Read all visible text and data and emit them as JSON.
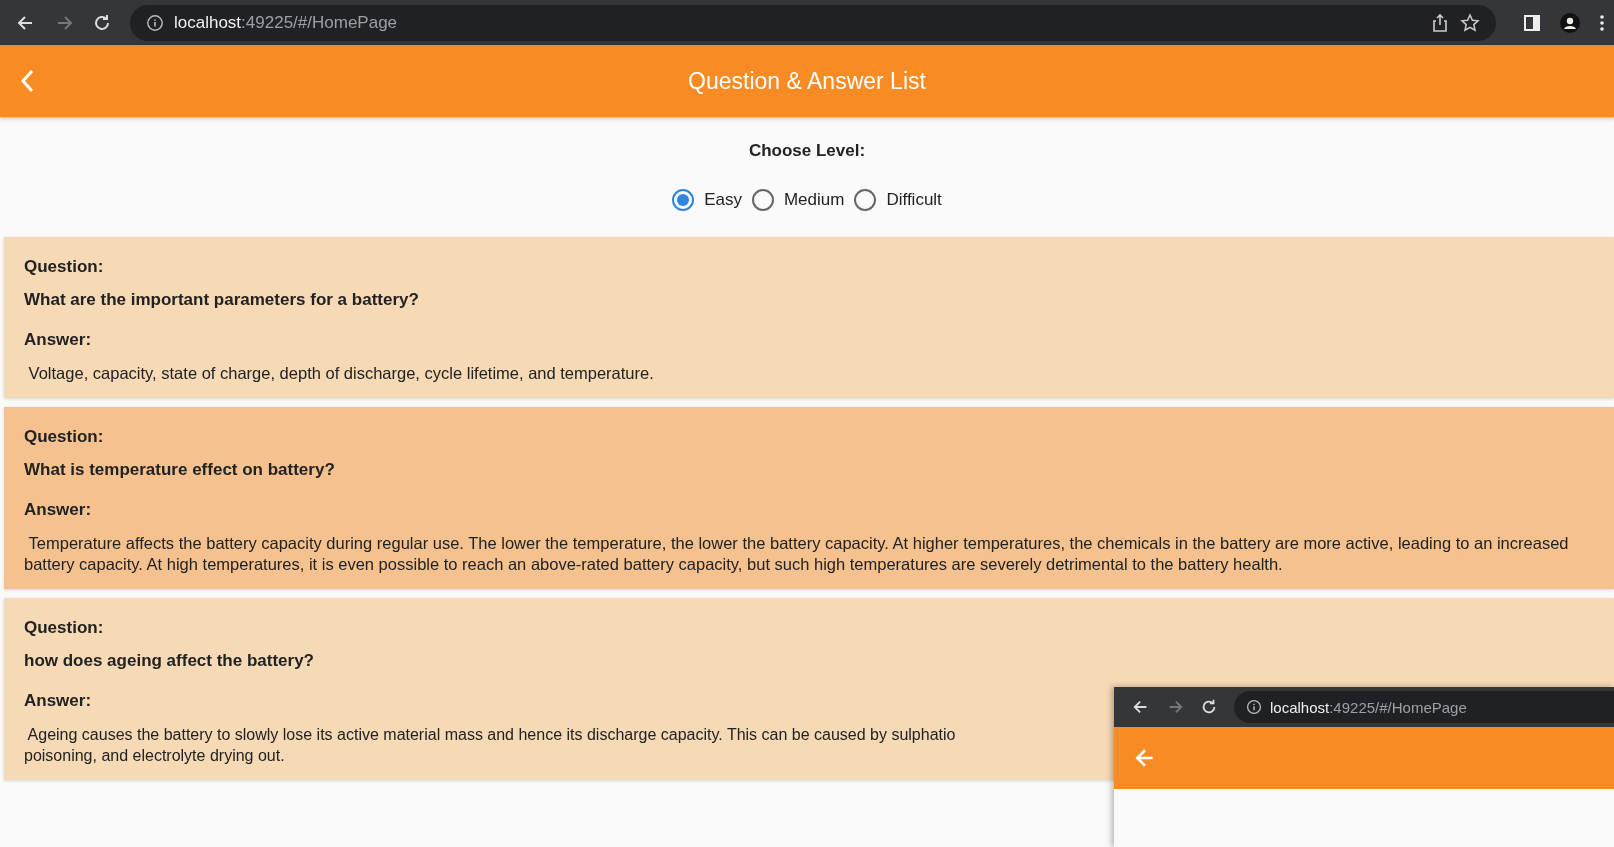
{
  "browser": {
    "url_host": "localhost",
    "url_rest": ":49225/#/HomePage"
  },
  "header": {
    "title": "Question & Answer List"
  },
  "level_picker": {
    "label": "Choose Level:",
    "options": [
      {
        "label": "Easy",
        "selected": true
      },
      {
        "label": "Medium",
        "selected": false
      },
      {
        "label": "Difficult",
        "selected": false
      }
    ]
  },
  "cards": [
    {
      "question_label": "Question:",
      "question": "What are the important parameters for a battery?",
      "answer_label": "Answer:",
      "answer_lines": [
        " Voltage, capacity, state of charge, depth of discharge, cycle lifetime, and temperature."
      ],
      "highlighted": false
    },
    {
      "question_label": "Question:",
      "question": "What is temperature effect on battery?",
      "answer_label": "Answer:",
      "answer_lines": [
        " Temperature affects the battery capacity during regular use. The lower the temperature, the lower the battery capacity. At higher temperatures, the chemicals in the battery are more active, leading to an increased battery capacity. At high temperatures, it is even possible to reach an above-rated battery capacity, but such high temperatures are severely detrimental to the battery health."
      ],
      "highlighted": true
    },
    {
      "question_label": "Question:",
      "question": "how does ageing affect the battery?",
      "answer_label": "Answer:",
      "answer_lines": [
        " Ageing causes the battery to slowly lose its active material mass and hence its discharge capacity. This can be caused by sulphatio",
        "poisoning, and electrolyte drying out."
      ],
      "highlighted": false
    }
  ],
  "overlay_window": {
    "url_host": "localhost",
    "url_rest": ":49225/#/HomePage"
  }
}
